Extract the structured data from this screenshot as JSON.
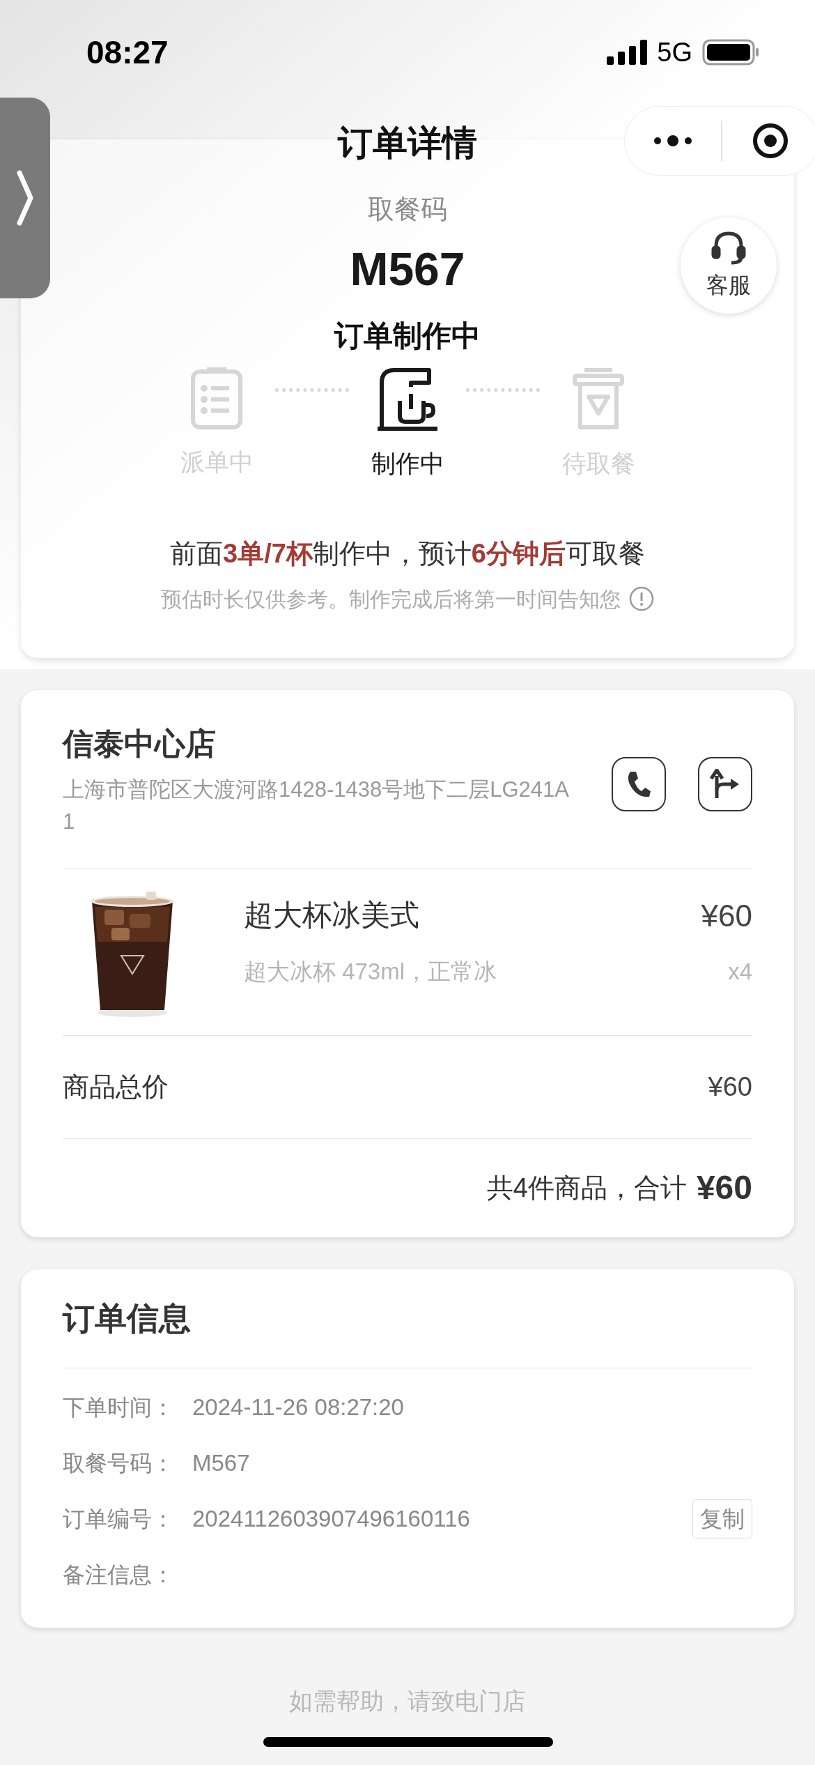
{
  "status_bar": {
    "time": "08:27",
    "network": "5G"
  },
  "nav": {
    "title": "订单详情"
  },
  "pickup": {
    "label": "取餐码",
    "code": "M567",
    "status": "订单制作中",
    "service": "客服"
  },
  "steps": [
    {
      "kind": "receipt",
      "label": "派单中",
      "active": false
    },
    {
      "kind": "machine",
      "label": "制作中",
      "active": true
    },
    {
      "kind": "cup",
      "label": "待取餐",
      "active": false
    }
  ],
  "queue_message": [
    {
      "text": "前面",
      "highlight": false
    },
    {
      "text": "3单/7杯",
      "highlight": true
    },
    {
      "text": "制作中，预计",
      "highlight": false
    },
    {
      "text": "6分钟后",
      "highlight": true
    },
    {
      "text": "可取餐",
      "highlight": false
    }
  ],
  "queue_note": "预估时长仅供参考。制作完成后将第一时间告知您",
  "store": {
    "name": "信泰中心店",
    "address": "上海市普陀区大渡河路1428-1438号地下二层LG241A1"
  },
  "items": [
    {
      "kind": "picture",
      "name": "超大杯冰美式",
      "spec": "超大冰杯 473ml，正常冰",
      "price": "¥60",
      "qty": "x4"
    }
  ],
  "subtotal": {
    "label": "商品总价",
    "value": "¥60"
  },
  "total": {
    "summary": "共4件商品，合计",
    "value": "¥60"
  },
  "order_info": {
    "title": "订单信息",
    "rows": [
      {
        "label": "下单时间：",
        "value": "2024-11-26 08:27:20"
      },
      {
        "label": "取餐号码：",
        "value": "M567"
      },
      {
        "label": "订单编号：",
        "value": "2024112603907496160116",
        "action": "复制"
      },
      {
        "label": "备注信息："
      }
    ]
  },
  "footer": "如需帮助，请致电门店"
}
